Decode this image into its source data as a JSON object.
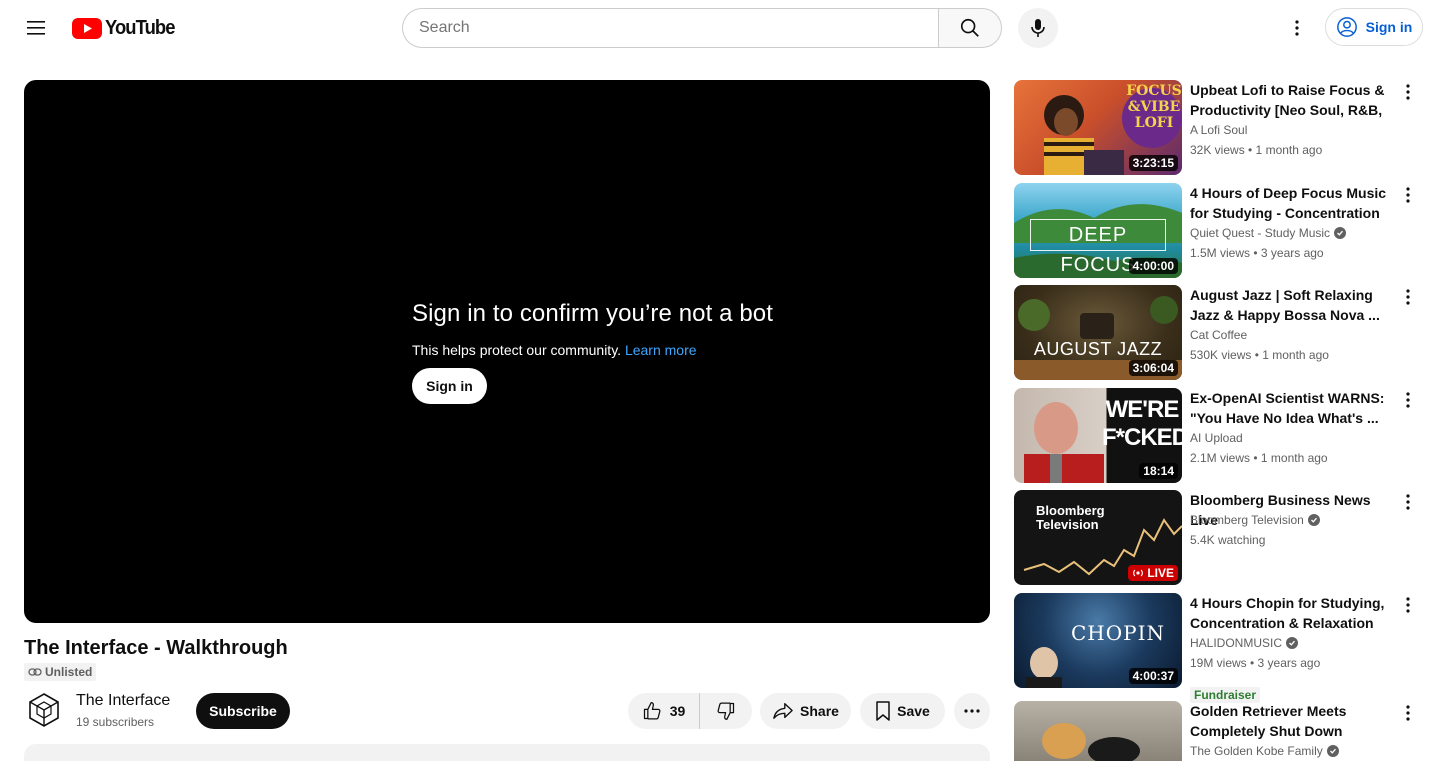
{
  "header": {
    "logo_text": "YouTube",
    "search_placeholder": "Search",
    "sign_in_label": "Sign in"
  },
  "player": {
    "message_title": "Sign in to confirm you’re not a bot",
    "message_sub": "This helps protect our community.",
    "learn_more": "Learn more",
    "sign_in_label": "Sign in"
  },
  "video": {
    "title": "The Interface - Walkthrough",
    "visibility": "Unlisted",
    "channel_name": "The Interface",
    "channel_subs": "19 subscribers",
    "subscribe_label": "Subscribe",
    "likes": "39",
    "share_label": "Share",
    "save_label": "Save"
  },
  "recommendations": [
    {
      "title": "Upbeat Lofi to Raise Focus & Productivity [Neo Soul, R&B, ...",
      "channel": "A Lofi Soul",
      "verified": false,
      "meta": "32K views • 1 month ago",
      "duration": "3:23:15",
      "thumb_text": "FOCUS &VIBE LOFI",
      "thumb_color": "#c94f2b"
    },
    {
      "title": "4 Hours of Deep Focus Music for Studying - Concentration ...",
      "channel": "Quiet Quest - Study Music",
      "verified": true,
      "meta": "1.5M views • 3 years ago",
      "duration": "4:00:00",
      "thumb_text": "DEEP FOCUS",
      "thumb_color": "#1f8a9e"
    },
    {
      "title": "August Jazz | Soft Relaxing Jazz & Happy Bossa Nova ...",
      "channel": "Cat Coffee",
      "verified": false,
      "meta": "530K views • 1 month ago",
      "duration": "3:06:04",
      "thumb_text": "AUGUST JAZZ",
      "thumb_color": "#5b4a2a"
    },
    {
      "title": "Ex-OpenAI Scientist WARNS: \"You Have No Idea What's ...",
      "channel": "AI Upload",
      "verified": false,
      "meta": "2.1M views • 1 month ago",
      "duration": "18:14",
      "thumb_text": "WE'RE F*CKED",
      "thumb_color": "#8a1a1a"
    },
    {
      "title": "Bloomberg Business News Live",
      "channel": "Bloomberg Television",
      "verified": true,
      "meta": "5.4K watching",
      "duration": "LIVE",
      "thumb_text": "Bloomberg Television",
      "thumb_color": "#1a1a1a"
    },
    {
      "title": "4 Hours Chopin for Studying, Concentration & Relaxation",
      "channel": "HALIDONMUSIC",
      "verified": true,
      "meta": "19M views • 3 years ago",
      "duration": "4:00:37",
      "thumb_text": "CHOPIN",
      "thumb_color": "#1b3a5e",
      "badge": "Fundraiser"
    },
    {
      "title": "Golden Retriever Meets Completely Shut Down Rescue...",
      "channel": "The Golden Kobe Family",
      "verified": true,
      "meta": "",
      "duration": "",
      "thumb_text": "",
      "thumb_color": "#8a8478"
    }
  ],
  "colors": {
    "brand_red": "#ff0000",
    "link_blue": "#065fd4"
  }
}
